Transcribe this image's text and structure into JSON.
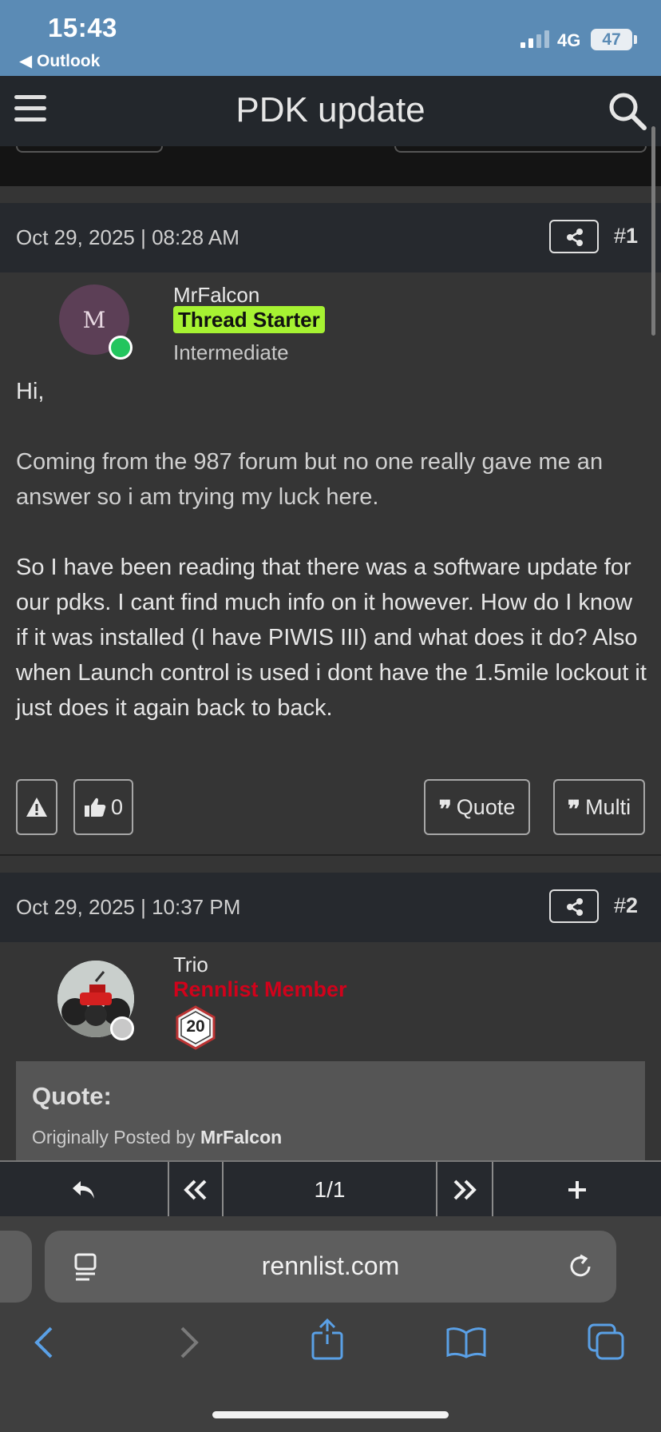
{
  "status_bar": {
    "time": "15:43",
    "back_app": "◀ Outlook",
    "network": "4G",
    "battery": "47"
  },
  "header": {
    "title": "PDK update",
    "menu_icon": "hamburger-menu-icon",
    "search_icon": "search-icon"
  },
  "posts": [
    {
      "date": "Oct 29, 2025 | 08:28 AM",
      "number_prefix": "#",
      "number": "1",
      "author": "MrFalcon",
      "avatar_letter": "M",
      "badge": "Thread Starter",
      "rank": "Intermediate",
      "online": true,
      "paragraphs": [
        "Hi,",
        "Coming from the 987 forum but no one really gave me an answer so i am trying my luck here.",
        "So I have been reading that there was a software update for our pdks. I cant find much info on it however. How do I know if it was installed (I have PIWIS III) and what does it do? Also when Launch control is used i dont have the 1.5mile lockout it just does it again back to back."
      ],
      "like_count": "0",
      "quote_label": "Quote",
      "multi_label": "Multi"
    },
    {
      "date": "Oct 29, 2025 | 10:37 PM",
      "number_prefix": "#",
      "number": "2",
      "author": "Trio",
      "member_label": "Rennlist Member",
      "post_badge": "20",
      "online": false,
      "quote_heading": "Quote:",
      "quote_prefix": "Originally Posted by",
      "quote_author": "MrFalcon"
    }
  ],
  "pager": {
    "page": "1/1"
  },
  "browser": {
    "url": "rennlist.com"
  },
  "colors": {
    "status_bar": "#5b8bb5",
    "header": "#23272c",
    "badge": "#a6f232",
    "member": "#d0021b",
    "online": "#22c55e",
    "link_blue": "#5aa0e6"
  }
}
